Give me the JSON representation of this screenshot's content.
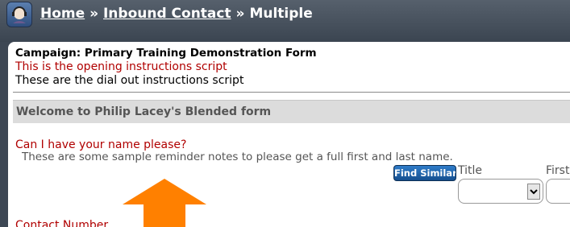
{
  "header": {
    "home_link": "Home",
    "sep1": " » ",
    "inbound_link": "Inbound Contact",
    "sep2": " » ",
    "current": "Multiple"
  },
  "form": {
    "campaign": "Campaign: Primary Training Demonstration Form",
    "opening_script": "This is the opening instructions script",
    "dialout_script": "These are the dial out instructions script",
    "welcome_banner": "Welcome to Philip Lacey's Blended form",
    "name_question": "Can I have your name please?",
    "name_notes": "These are some sample reminder notes to please get a full first and last name.",
    "find_similar_label": "Find Similar",
    "title_label": "Title",
    "first_label": "First",
    "title_value": "",
    "first_value": "",
    "contact_number_label": "Contact Number"
  },
  "colors": {
    "accent": "#ff8000",
    "script_red": "#b00000",
    "header_bg": "#3d4754",
    "button_blue": "#1f63ad"
  },
  "icons": {
    "app_icon": "agent-headset-icon",
    "pointer": "up-arrow-icon",
    "select_arrow": "chevron-down-icon"
  }
}
